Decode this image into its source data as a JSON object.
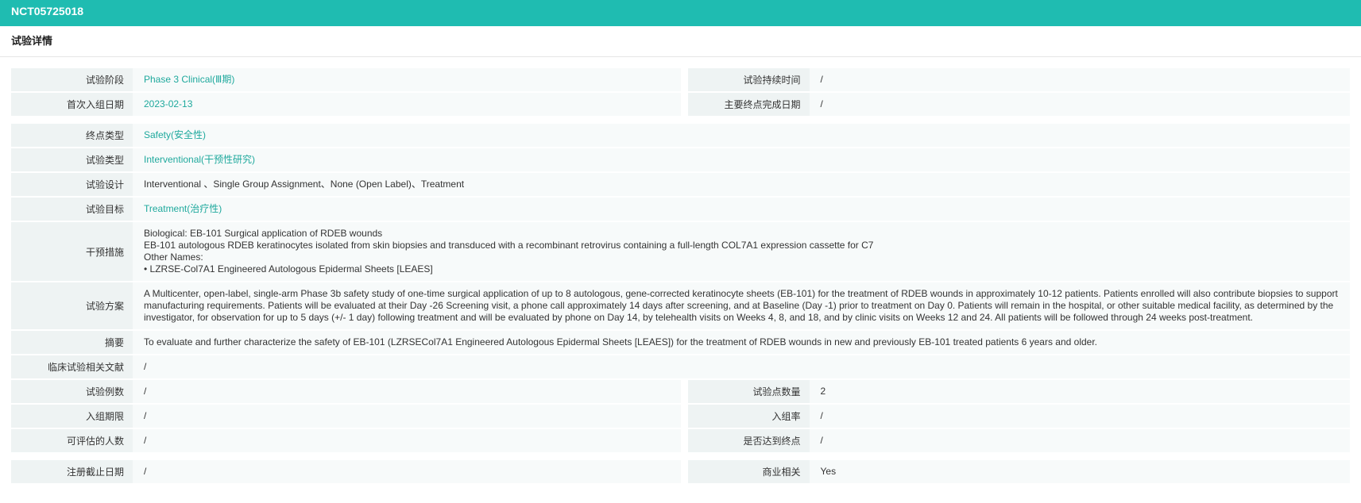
{
  "header": {
    "trial_id": "NCT05725018"
  },
  "section": {
    "title": "试验详情"
  },
  "fields": {
    "phase": {
      "label": "试验阶段",
      "value": "Phase 3 Clinical(Ⅲ期)"
    },
    "duration": {
      "label": "试验持续时间",
      "value": "/"
    },
    "first_enroll": {
      "label": "首次入组日期",
      "value": "2023-02-13"
    },
    "primary_completion": {
      "label": "主要终点完成日期",
      "value": "/"
    },
    "endpoint_type": {
      "label": "终点类型",
      "value": "Safety(安全性)"
    },
    "trial_type": {
      "label": "试验类型",
      "value": "Interventional(干预性研究)"
    },
    "design": {
      "label": "试验设计",
      "value": "Interventional 、Single Group Assignment、None (Open Label)、Treatment"
    },
    "objective": {
      "label": "试验目标",
      "value": "Treatment(治疗性)"
    },
    "intervention": {
      "label": "干预措施",
      "lines": [
        "Biological: EB-101 Surgical application of RDEB wounds",
        "EB-101 autologous RDEB keratinocytes isolated from skin biopsies and transduced with a recombinant retrovirus containing a full-length COL7A1 expression cassette for C7",
        "Other Names:",
        "• LZRSE-Col7A1 Engineered Autologous Epidermal Sheets [LEAES]"
      ]
    },
    "protocol": {
      "label": "试验方案",
      "value": "A Multicenter, open-label, single-arm Phase 3b safety study of one-time surgical application of up to 8 autologous, gene-corrected keratinocyte sheets (EB-101) for the treatment of RDEB wounds in approximately 10-12 patients. Patients enrolled will also contribute biopsies to support manufacturing requirements. Patients will be evaluated at their Day -26 Screening visit, a phone call approximately 14 days after screening, and at Baseline (Day -1) prior to treatment on Day 0. Patients will remain in the hospital, or other suitable medical facility, as determined by the investigator, for observation for up to 5 days (+/- 1 day) following treatment and will be evaluated by phone on Day 14, by telehealth visits on Weeks 4, 8, and 18, and by clinic visits on Weeks 12 and 24. All patients will be followed through 24 weeks post-treatment."
    },
    "summary": {
      "label": "摘要",
      "value": "To evaluate and further characterize the safety of EB-101 (LZRSECol7A1 Engineered Autologous Epidermal Sheets [LEAES]) for the treatment of RDEB wounds in new and previously EB-101 treated patients 6 years and older."
    },
    "literature": {
      "label": "临床试验相关文献",
      "value": "/"
    },
    "case_count": {
      "label": "试验例数",
      "value": "/"
    },
    "site_count": {
      "label": "试验点数量",
      "value": "2"
    },
    "enroll_period": {
      "label": "入组期限",
      "value": "/"
    },
    "enroll_rate": {
      "label": "入组率",
      "value": "/"
    },
    "evaluable": {
      "label": "可评估的人数",
      "value": "/"
    },
    "endpoint_met": {
      "label": "是否达到终点",
      "value": "/"
    },
    "reg_deadline": {
      "label": "注册截止日期",
      "value": "/"
    },
    "commercial": {
      "label": "商业相关",
      "value": "Yes"
    }
  }
}
